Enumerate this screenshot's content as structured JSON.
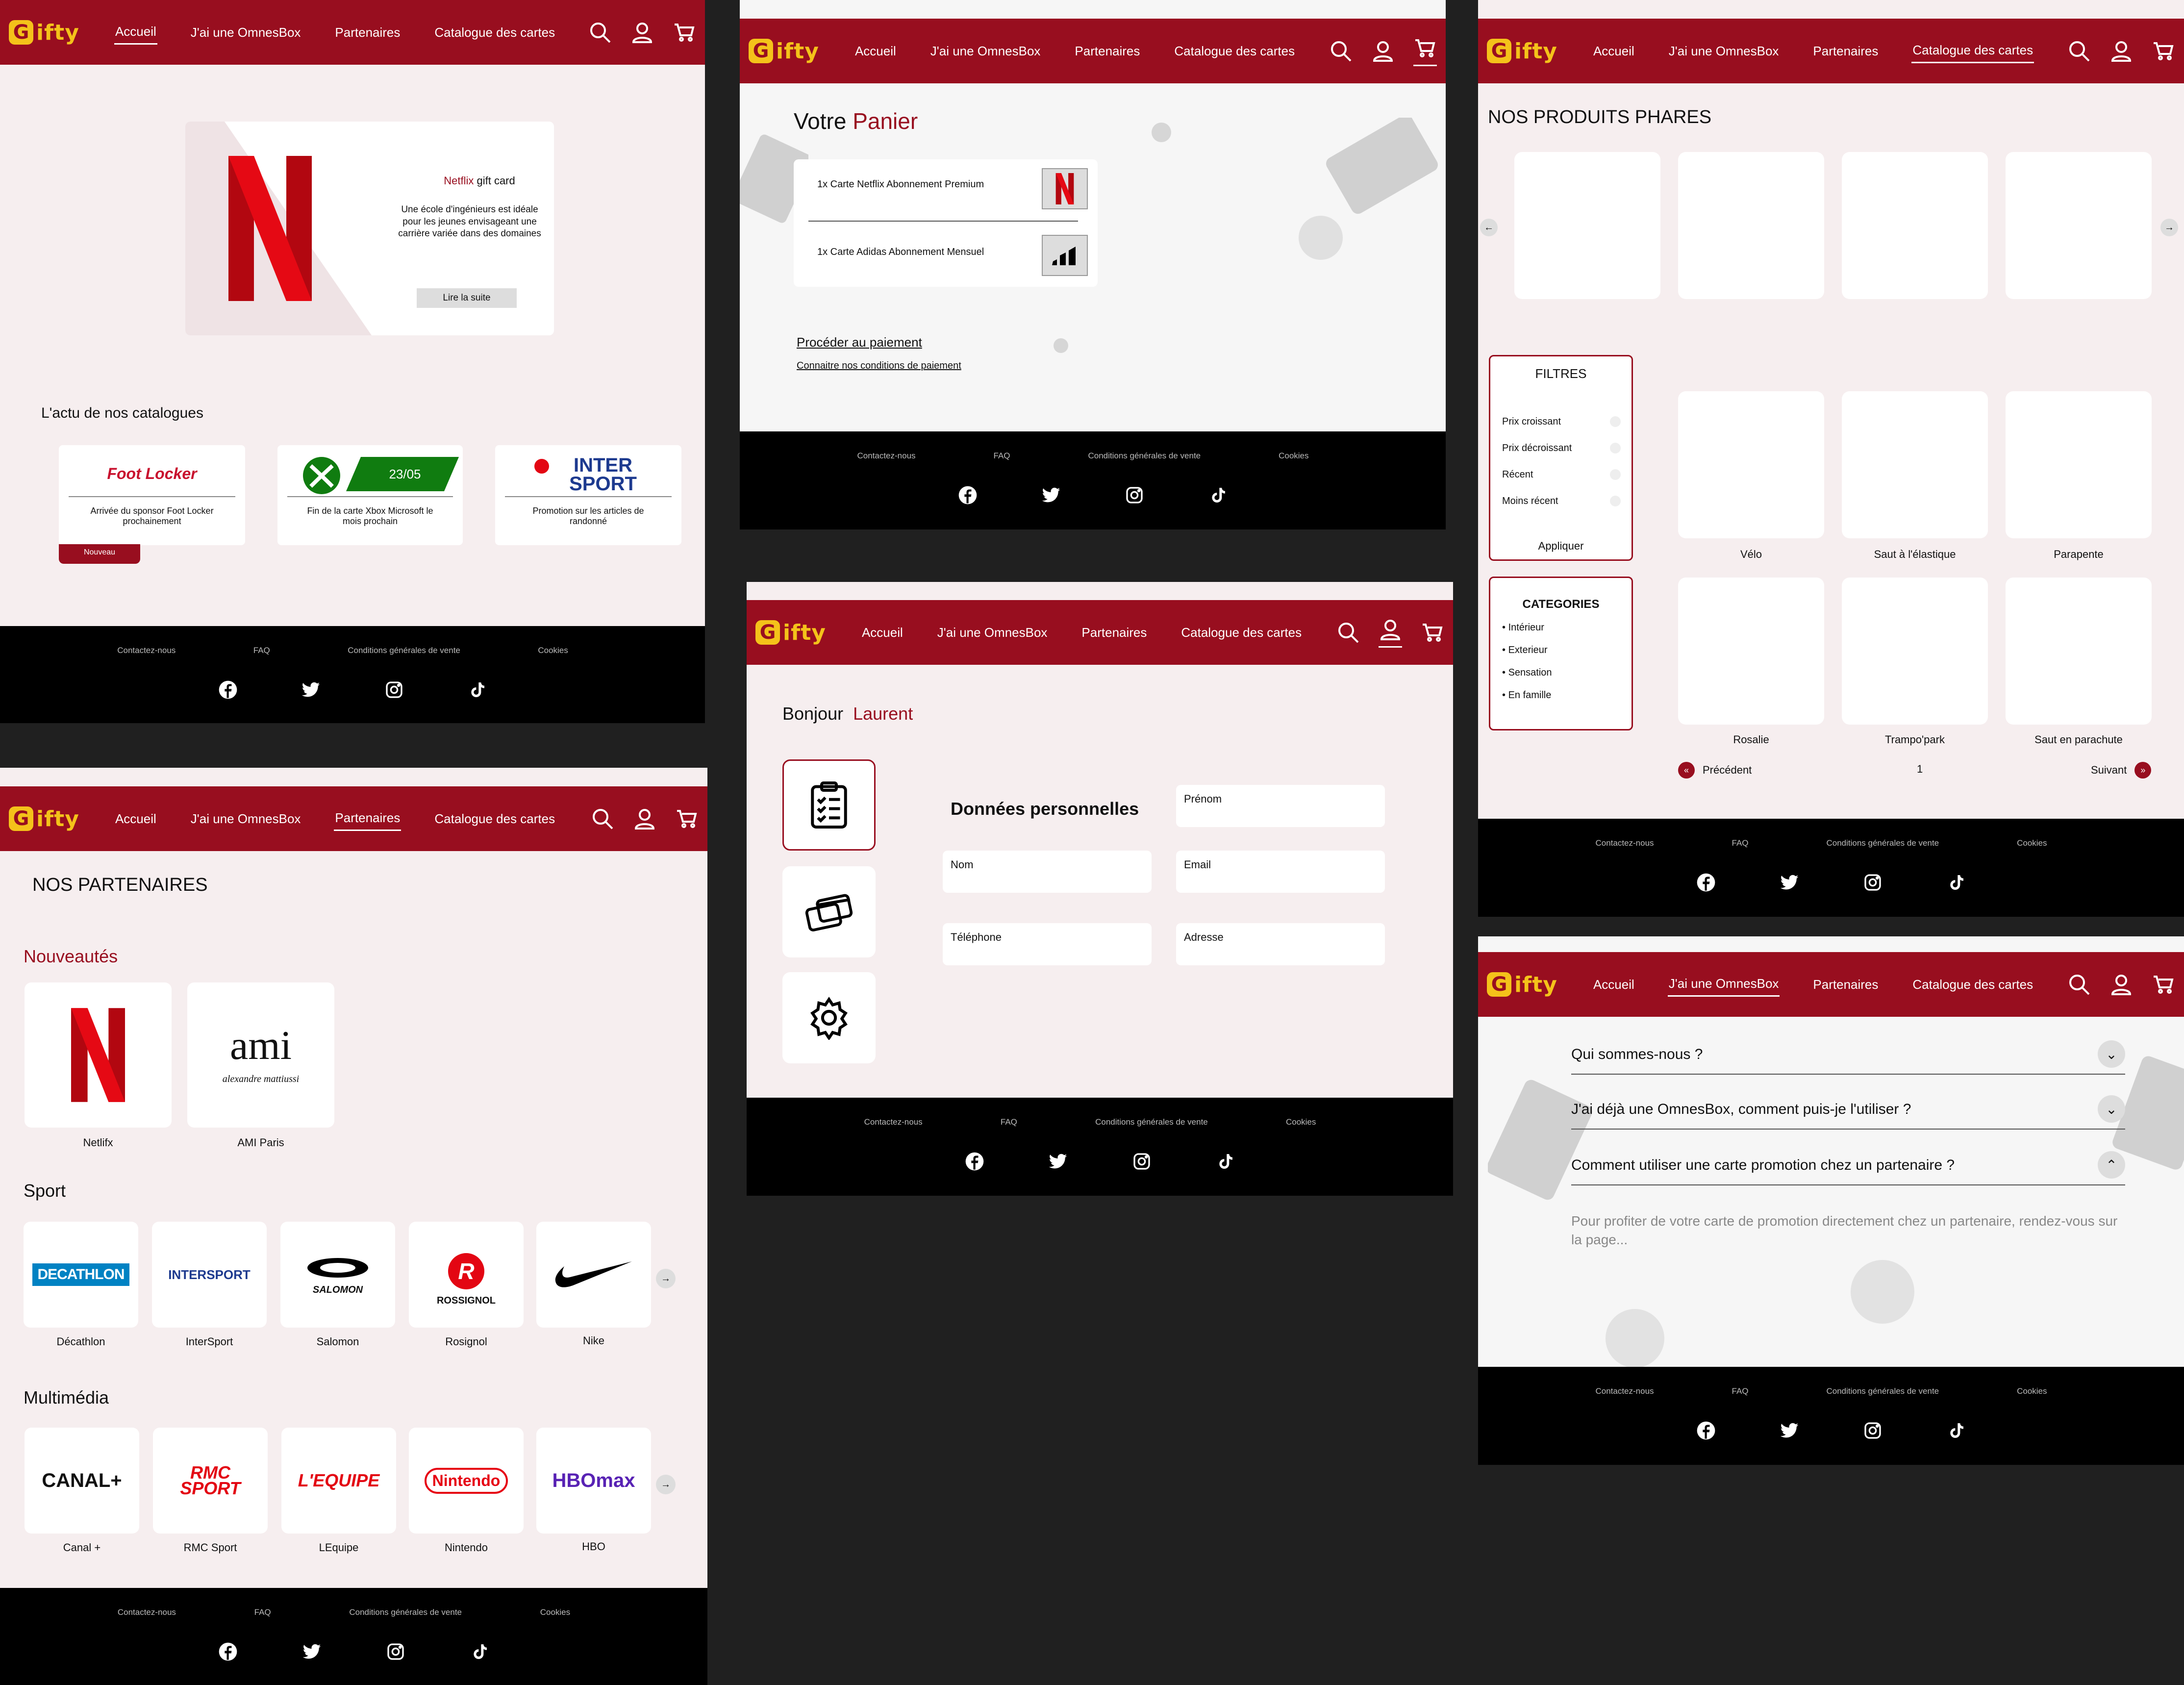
{
  "brand": {
    "logo_letter": "G",
    "logo_text": "ifty",
    "color_primary": "#980e1f",
    "color_logo": "#f4c21a"
  },
  "nav": {
    "home": "Accueil",
    "omnesbox": "J'ai une OmnesBox",
    "partners": "Partenaires",
    "catalog": "Catalogue des cartes"
  },
  "footer": {
    "contact": "Contactez-nous",
    "faq": "FAQ",
    "cgv": "Conditions générales de vente",
    "cookies": "Cookies"
  },
  "home": {
    "hero_brand": "Netflix",
    "hero_title": " gift card",
    "hero_text": "Une école d'ingénieurs est idéale pour les jeunes envisageant une carrière variée dans des domaines",
    "hero_button": "Lire la suite",
    "news_title": "L'actu de nos catalogues",
    "news": [
      {
        "logo": "Foot Locker",
        "text": "Arrivée du sponsor Foot Locker prochainement",
        "badge": "Nouveau"
      },
      {
        "logo": "23/05",
        "text": "Fin de la carte Xbox Microsoft le mois prochain"
      },
      {
        "logo": "INTER SPORT",
        "text": "Promotion sur les articles de randonné"
      }
    ]
  },
  "cart": {
    "title_a": "Votre",
    "title_b": "Panier",
    "items": [
      "1x Carte Netflix Abonnement Premium",
      "1x Carte Adidas Abonnement Mensuel"
    ],
    "checkout": "Procéder au paiement",
    "conditions": "Connaitre nos conditions de paiement"
  },
  "profile": {
    "hello": "Bonjour",
    "name": "Laurent",
    "section": "Données personnelles",
    "fields": {
      "prenom": "Prénom",
      "nom": "Nom",
      "email": "Email",
      "telephone": "Téléphone",
      "adresse": "Adresse"
    }
  },
  "catalog": {
    "title": "NOS PRODUITS PHARES",
    "filters_title": "FILTRES",
    "filters": [
      "Prix croissant",
      "Prix décroissant",
      "Récent",
      "Moins récent"
    ],
    "apply": "Appliquer",
    "categories_title": "CATEGORIES",
    "categories": [
      "Intérieur",
      "Exterieur",
      "Sensation",
      "En famille"
    ],
    "products": [
      "Vélo",
      "Saut à l'élastique",
      "Parapente",
      "Rosalie",
      "Trampo'park",
      "Saut en parachute"
    ],
    "prev": "Précédent",
    "page": "1",
    "next": "Suivant"
  },
  "partners": {
    "title": "NOS PARTENAIRES",
    "new_title": "Nouveautés",
    "new": [
      {
        "logo": "N",
        "label": "Netlifx"
      },
      {
        "logo": "ami",
        "sub": "alexandre mattiussi",
        "label": "AMI Paris"
      }
    ],
    "sport_title": "Sport",
    "sport": [
      {
        "logo": "DECATHLON",
        "label": "Décathlon"
      },
      {
        "logo": "INTERSPORT",
        "label": "InterSport"
      },
      {
        "logo": "SALOMON",
        "label": "Salomon"
      },
      {
        "logo": "ROSSIGNOL",
        "label": "Rosignol"
      },
      {
        "logo": "",
        "label": "Nike"
      }
    ],
    "media_title": "Multimédia",
    "media": [
      {
        "logo": "CANAL+",
        "label": "Canal +"
      },
      {
        "logo": "RMC SPORT",
        "label": "RMC Sport"
      },
      {
        "logo": "L'EQUIPE",
        "label": "LEquipe"
      },
      {
        "logo": "Nintendo",
        "label": "Nintendo"
      },
      {
        "logo": "HBOmax",
        "label": "HBO"
      }
    ]
  },
  "faq": {
    "q1": "Qui sommes-nous ?",
    "q2": "J'ai déjà une OmnesBox, comment puis-je l'utiliser ?",
    "q3": "Comment utiliser une carte promotion chez un partenaire ?",
    "answer": "Pour profiter de votre carte de promotion directement chez un partenaire, rendez-vous sur la page..."
  }
}
